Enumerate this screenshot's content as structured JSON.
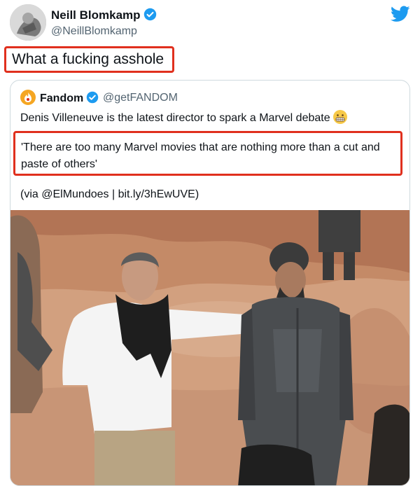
{
  "tweet": {
    "author_name": "Neill Blomkamp",
    "author_handle": "@NeillBlomkamp",
    "text": "What a fucking asshole"
  },
  "quote": {
    "author_name": "Fandom",
    "author_handle": "@getFANDOM",
    "line1": "Denis Villeneuve is the latest director to spark a Marvel debate",
    "emoji": "grimacing-face-icon",
    "highlight": "'There are too many Marvel movies that are nothing more than a cut and paste of others'",
    "via": "(via @ElMundoes | bit.ly/3hEwUVE)"
  },
  "colors": {
    "verified": "#1d9bf0",
    "twitter_blue": "#1d9bf0",
    "highlight_border": "#e0301e",
    "fandom_orange": "#f5a623"
  },
  "icons": {
    "verified": "verified-badge-icon",
    "brand": "twitter-bird-icon"
  }
}
